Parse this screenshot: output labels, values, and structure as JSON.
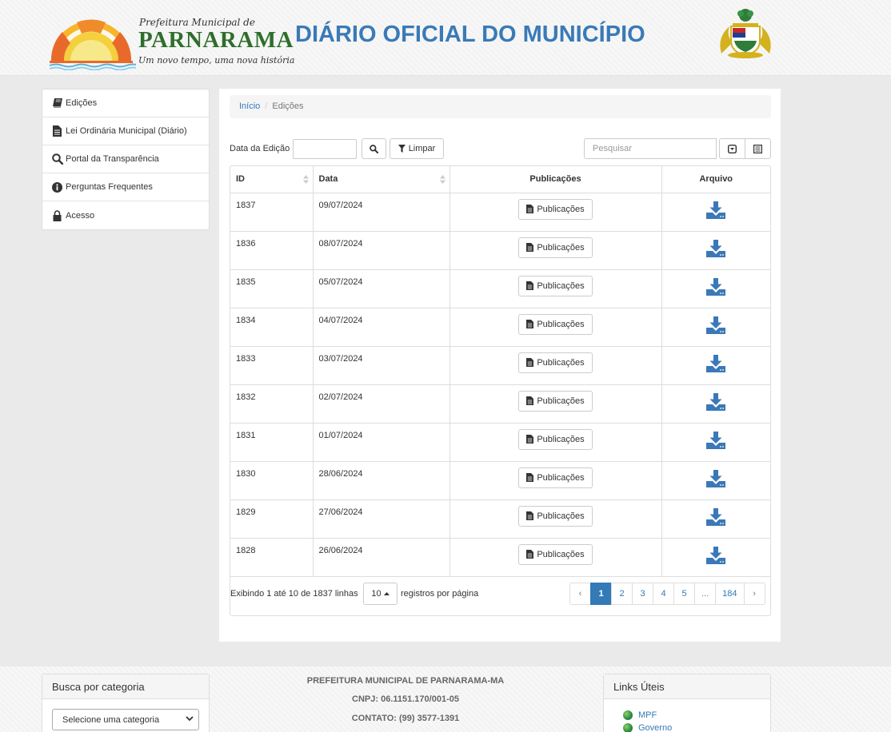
{
  "header": {
    "logo_prefeitura": "Prefeitura Municipal de",
    "logo_city": "PARNARAMA",
    "logo_slogan": "Um novo tempo, uma nova história",
    "site_title": "DIÁRIO OFICIAL DO MUNICÍPIO"
  },
  "sidebar": {
    "items": [
      {
        "label": "Edições",
        "icon": "book-icon"
      },
      {
        "label": "Lei Ordinária Municipal (Diário)",
        "icon": "document-icon"
      },
      {
        "label": "Portal da Transparência",
        "icon": "search-icon"
      },
      {
        "label": "Perguntas Frequentes",
        "icon": "info-icon"
      },
      {
        "label": "Acesso",
        "icon": "lock-icon"
      }
    ]
  },
  "breadcrumb": {
    "home": "Início",
    "current": "Edições"
  },
  "filter": {
    "date_label": "Data da Edição",
    "clear_label": "Limpar",
    "search_placeholder": "Pesquisar"
  },
  "table": {
    "headers": {
      "id": "ID",
      "date": "Data",
      "publications": "Publicações",
      "file": "Arquivo"
    },
    "button_label": "Publicações",
    "rows": [
      {
        "id": "1837",
        "date": "09/07/2024"
      },
      {
        "id": "1836",
        "date": "08/07/2024"
      },
      {
        "id": "1835",
        "date": "05/07/2024"
      },
      {
        "id": "1834",
        "date": "04/07/2024"
      },
      {
        "id": "1833",
        "date": "03/07/2024"
      },
      {
        "id": "1832",
        "date": "02/07/2024"
      },
      {
        "id": "1831",
        "date": "01/07/2024"
      },
      {
        "id": "1830",
        "date": "28/06/2024"
      },
      {
        "id": "1829",
        "date": "27/06/2024"
      },
      {
        "id": "1828",
        "date": "26/06/2024"
      }
    ]
  },
  "paging": {
    "showing": "Exibindo 1 até 10 de 1837 linhas",
    "per_page": "10",
    "per_page_label": "registros por página",
    "prev": "‹",
    "next": "›",
    "pages": [
      "1",
      "2",
      "3",
      "4",
      "5",
      "...",
      "184"
    ],
    "active_page": "1"
  },
  "footer": {
    "category_title": "Busca por categoria",
    "category_placeholder": "Selecione uma categoria",
    "org_name": "PREFEITURA MUNICIPAL DE PARNARAMA-MA",
    "cnpj": "CNPJ: 06.1151.170/001-05",
    "contact": "CONTATO: (99) 3577-1391",
    "links_title": "Links Úteis",
    "links": [
      "MPF",
      "Governo"
    ]
  },
  "colors": {
    "accent": "#337ab7",
    "title_blue": "#3a7ab7",
    "logo_green": "#2e6e2a",
    "download_icon": "#3b78b8"
  }
}
